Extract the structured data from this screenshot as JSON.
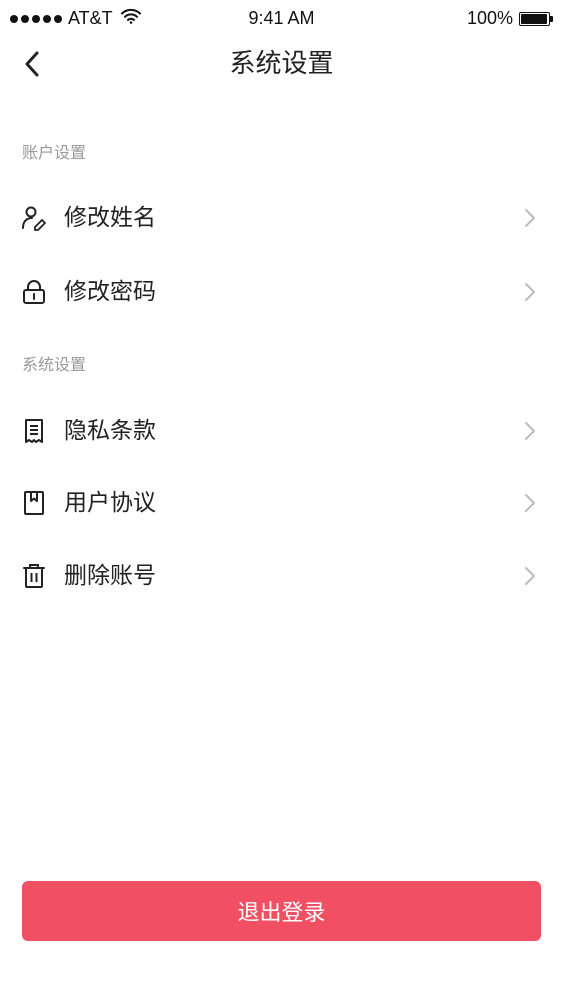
{
  "status_bar": {
    "carrier": "AT&T",
    "time": "9:41 AM",
    "battery": "100%"
  },
  "nav": {
    "title": "系统设置",
    "back_icon": "chevron-left-icon"
  },
  "sections": [
    {
      "label": "账户设置",
      "items": [
        {
          "label": "修改姓名",
          "icon": "user-edit-icon"
        },
        {
          "label": "修改密码",
          "icon": "lock-icon"
        }
      ]
    },
    {
      "label": "系统设置",
      "items": [
        {
          "label": "隐私条款",
          "icon": "document-icon"
        },
        {
          "label": "用户协议",
          "icon": "bookmark-doc-icon"
        },
        {
          "label": "删除账号",
          "icon": "trash-icon"
        }
      ]
    }
  ],
  "logout": {
    "label": "退出登录",
    "color": "#f04f64"
  },
  "colors": {
    "section_label": "#999999",
    "chevron": "#bbbbbb",
    "text": "#222222"
  }
}
